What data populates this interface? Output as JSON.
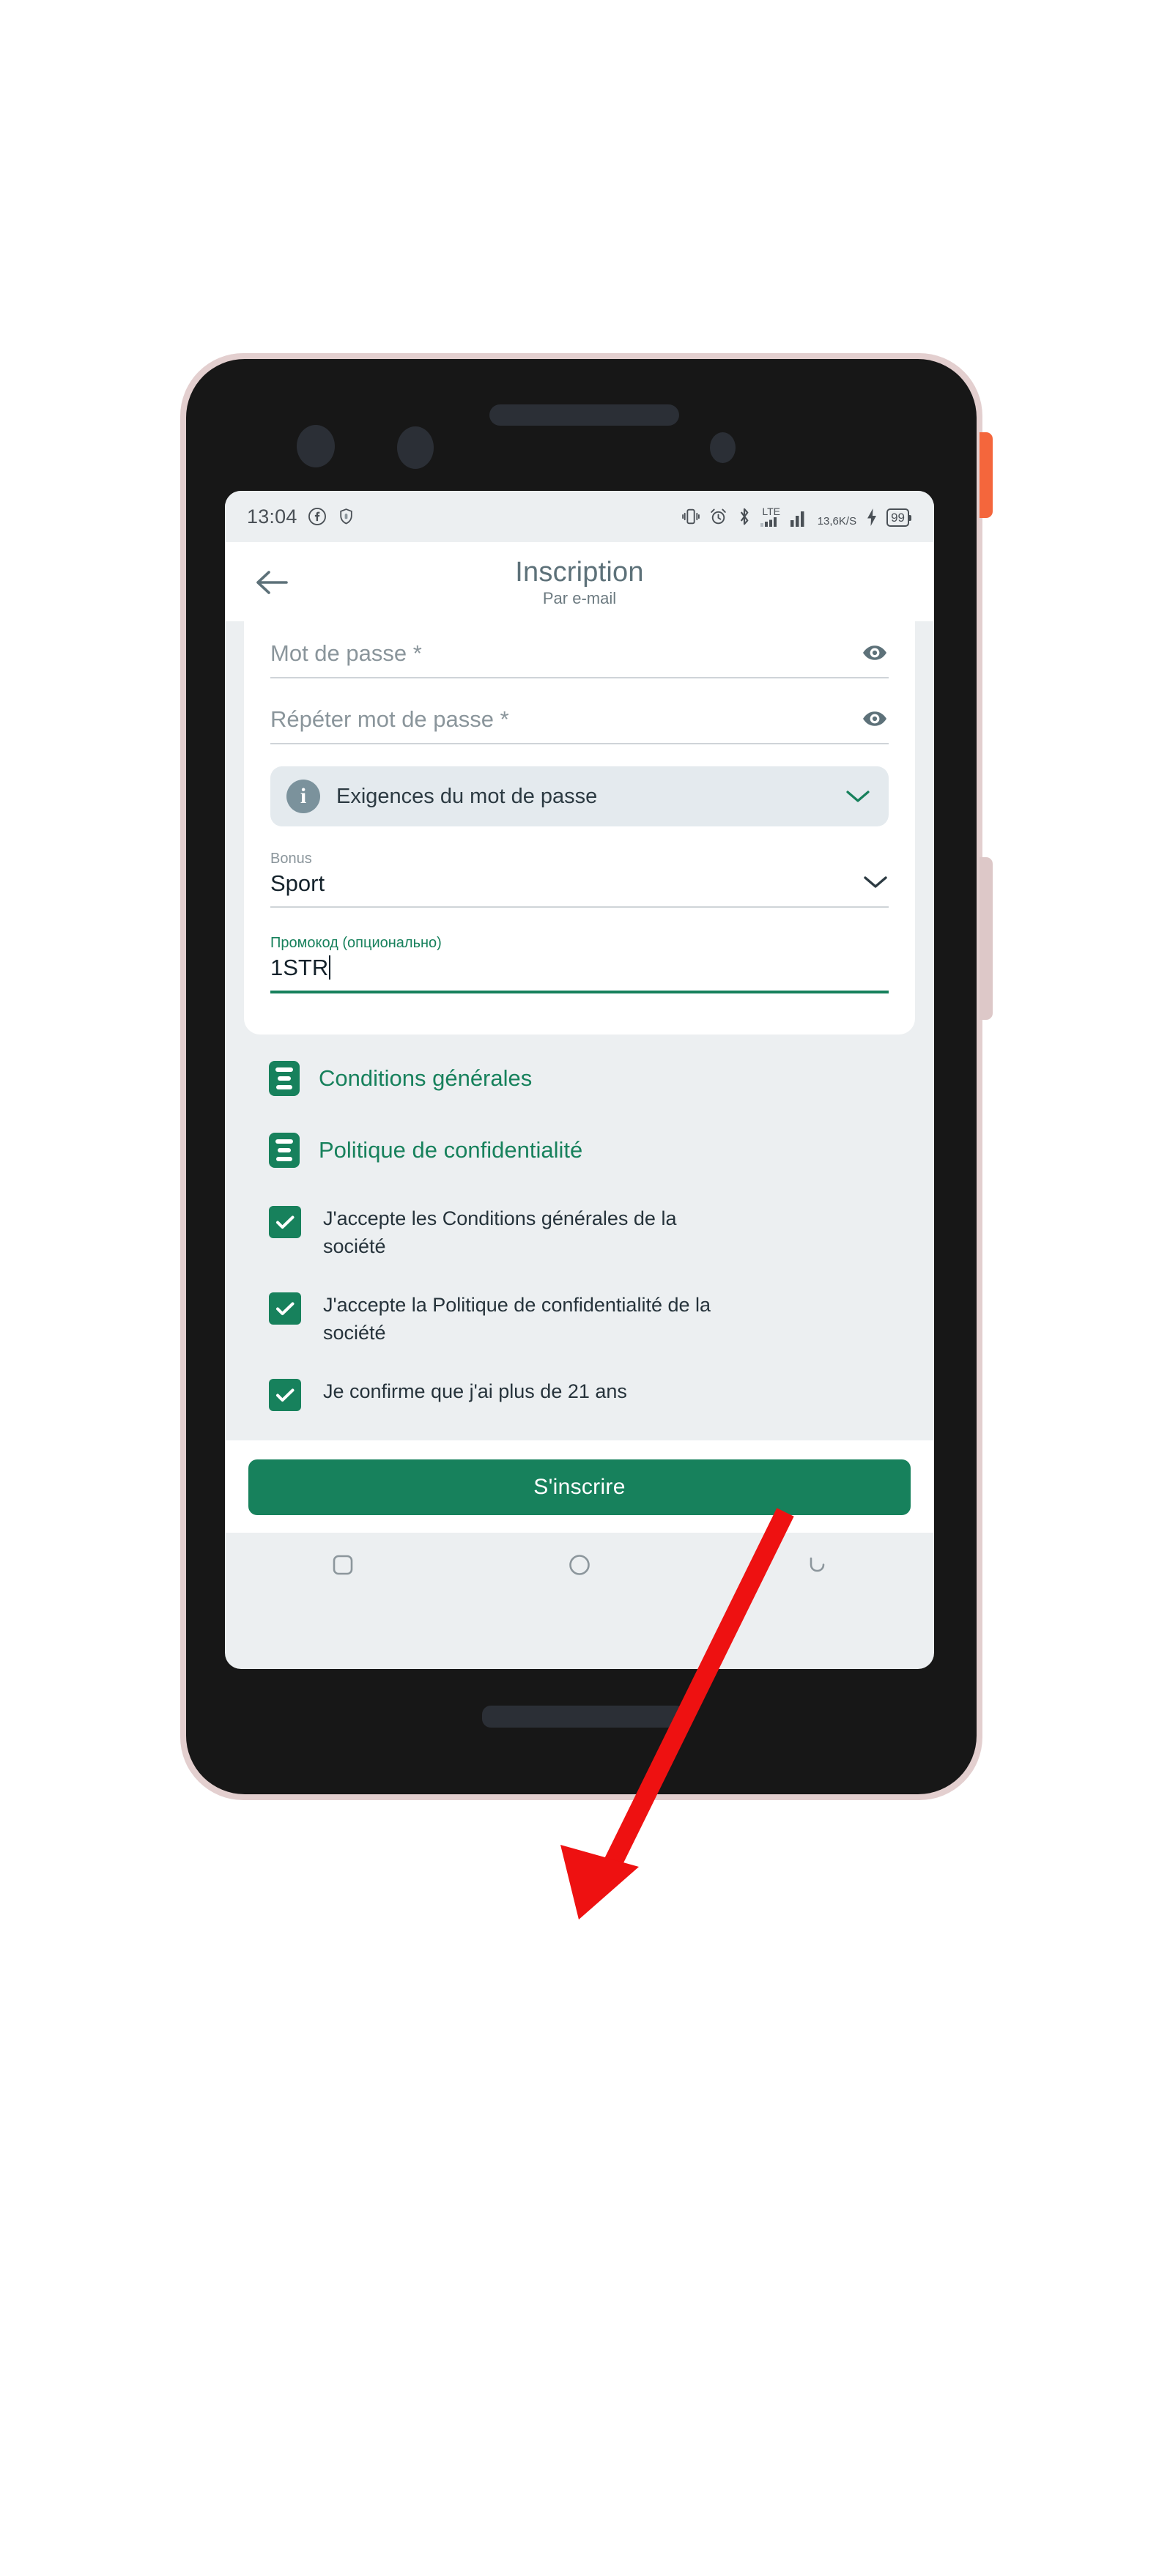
{
  "device": {
    "frame_color": "#e3cfcf",
    "body_color": "#171717",
    "power_button_color": "#f4663c",
    "volume_button_color": "#ddc8c8"
  },
  "status_bar": {
    "clock": "13:04",
    "icons_left": [
      "facebook-icon",
      "shield-icon"
    ],
    "icons_right": [
      "vibrate-icon",
      "alarm-icon",
      "bluetooth-icon",
      "lte-signal-icon",
      "signal-bars-icon",
      "data-speed",
      "charging-bolt-icon",
      "battery-icon"
    ],
    "lte_label": "LTE",
    "data_speed_value": "13,6",
    "data_speed_unit": "K/S",
    "battery_level": "99"
  },
  "header": {
    "back_icon": "arrow-left-icon",
    "title": "Inscription",
    "subtitle": "Par e-mail"
  },
  "form": {
    "password": {
      "placeholder": "Mot de passe *",
      "value": "",
      "toggle_icon": "eye-icon"
    },
    "repeat_password": {
      "placeholder": "Répéter mot de passe *",
      "value": "",
      "toggle_icon": "eye-icon"
    },
    "password_requirements": {
      "icon": "info-icon",
      "label": "Exigences du mot de passe",
      "expand_icon": "chevron-down-icon"
    },
    "bonus": {
      "label": "Bonus",
      "value": "Sport",
      "expand_icon": "chevron-down-icon"
    },
    "promocode": {
      "label": "Промокод (опционально)",
      "value": "1STR",
      "focused": true,
      "accent_color": "#17815c"
    }
  },
  "agreements": {
    "documents": [
      {
        "icon": "document-icon",
        "label": "Conditions générales"
      },
      {
        "icon": "document-icon",
        "label": "Politique de confidentialité"
      }
    ],
    "checkboxes": [
      {
        "checked": true,
        "label": "J'accepte les Conditions générales de la société"
      },
      {
        "checked": true,
        "label": "J'accepte la Politique de confidentialité de la société"
      },
      {
        "checked": true,
        "label": "Je confirme que j'ai plus de 21 ans"
      }
    ]
  },
  "submit": {
    "label": "S'inscrire",
    "color": "#17815c"
  },
  "nav_bar": {
    "buttons": [
      {
        "icon": "recents-square-icon"
      },
      {
        "icon": "home-circle-icon"
      },
      {
        "icon": "back-arrow-icon"
      }
    ]
  },
  "annotation": {
    "arrow_color": "#ee1111",
    "points_to": "S'inscrire"
  }
}
